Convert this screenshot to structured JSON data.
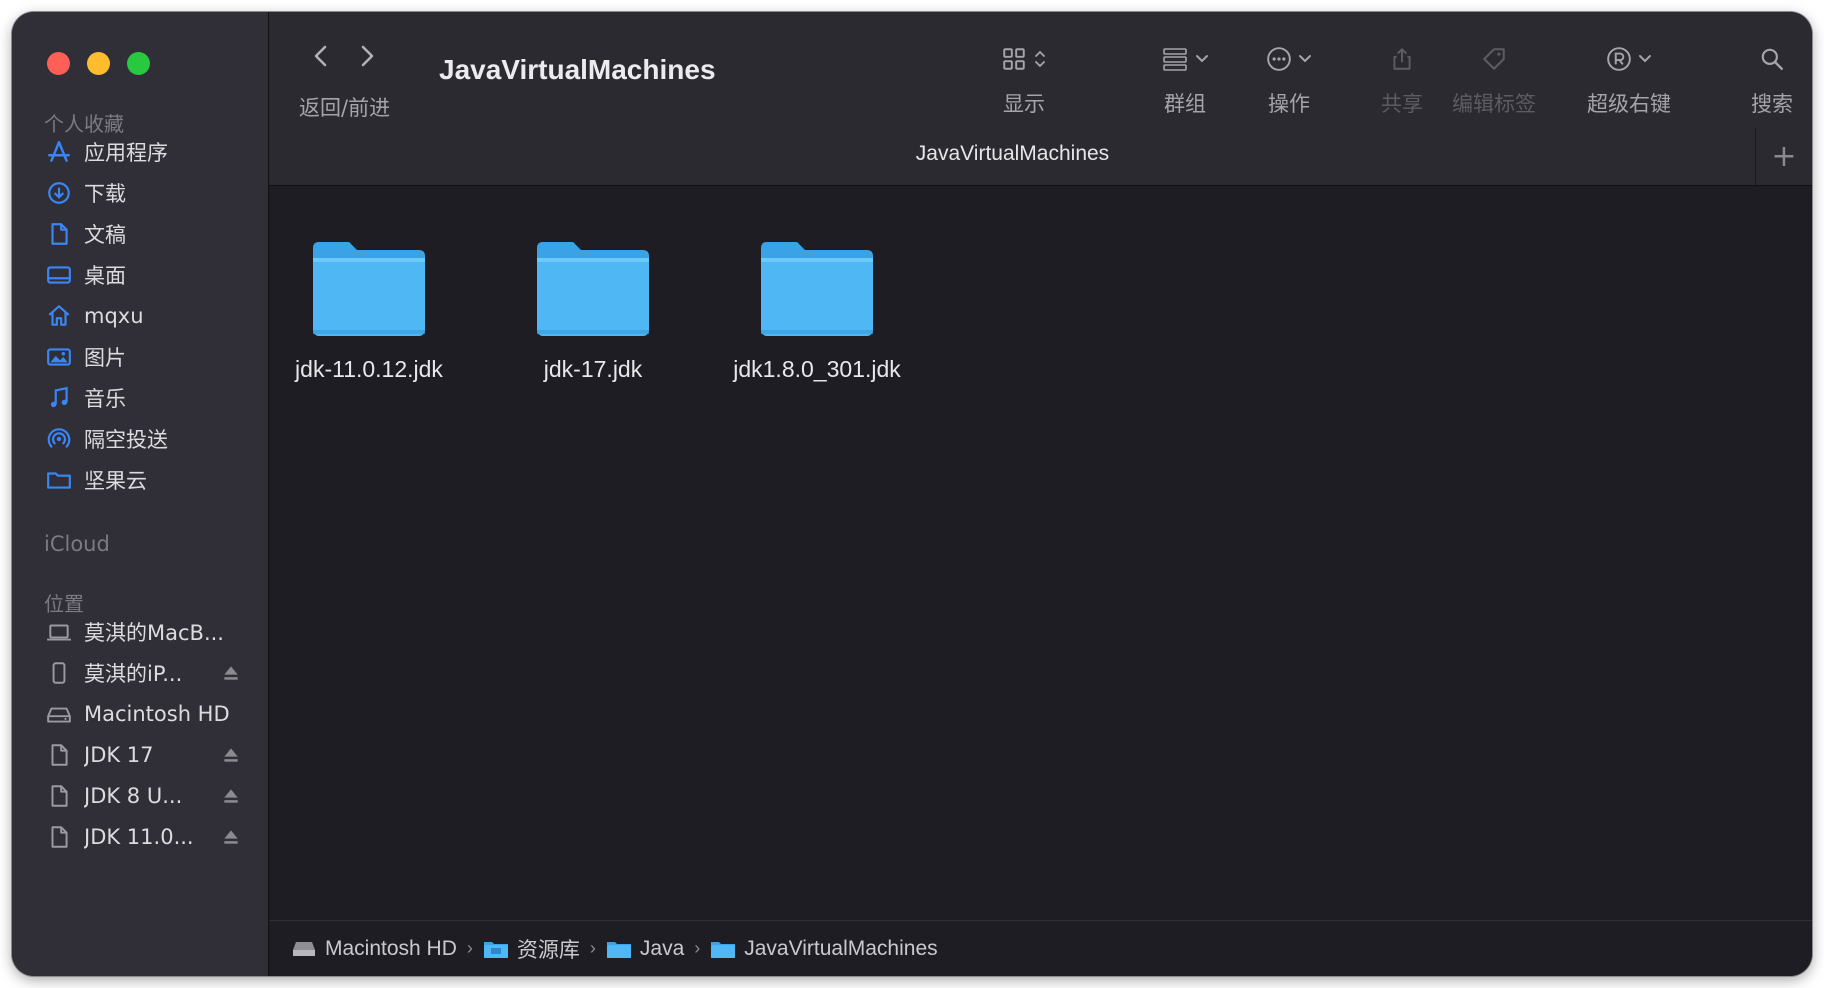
{
  "window": {
    "title": "JavaVirtualMachines",
    "tab_title": "JavaVirtualMachines",
    "tab_add_label": "+"
  },
  "toolbar": {
    "nav_label": "返回/前进",
    "view_label": "显示",
    "group_label": "群组",
    "action_label": "操作",
    "share_label": "共享",
    "tags_label": "编辑标签",
    "super_right_label": "超级右键",
    "search_label": "搜索"
  },
  "sidebar": {
    "favorites_header": "个人收藏",
    "favorites": [
      {
        "label": "应用程序",
        "icon": "applications-icon"
      },
      {
        "label": "下载",
        "icon": "downloads-icon"
      },
      {
        "label": "文稿",
        "icon": "document-icon"
      },
      {
        "label": "桌面",
        "icon": "desktop-icon"
      },
      {
        "label": "mqxu",
        "icon": "home-icon"
      },
      {
        "label": "图片",
        "icon": "pictures-icon"
      },
      {
        "label": "音乐",
        "icon": "music-icon"
      },
      {
        "label": "隔空投送",
        "icon": "airdrop-icon"
      },
      {
        "label": "坚果云",
        "icon": "folder-icon"
      }
    ],
    "icloud_header": "iCloud",
    "locations_header": "位置",
    "locations": [
      {
        "label": "莫淇的MacB...",
        "icon": "laptop-icon",
        "eject": false
      },
      {
        "label": "莫淇的iP...",
        "icon": "phone-icon",
        "eject": true
      },
      {
        "label": "Macintosh HD",
        "icon": "drive-icon",
        "eject": false
      },
      {
        "label": "JDK 17",
        "icon": "disk-image-icon",
        "eject": true
      },
      {
        "label": "JDK 8 U...",
        "icon": "disk-image-icon",
        "eject": true
      },
      {
        "label": "JDK 11.0...",
        "icon": "disk-image-icon",
        "eject": true
      }
    ]
  },
  "files": [
    {
      "name": "jdk-11.0.12.jdk"
    },
    {
      "name": "jdk-17.jdk"
    },
    {
      "name": "jdk1.8.0_301.jdk"
    }
  ],
  "pathbar": [
    {
      "label": "Macintosh HD",
      "icon": "drive-icon"
    },
    {
      "label": "资源库",
      "icon": "library-folder-icon"
    },
    {
      "label": "Java",
      "icon": "folder-icon"
    },
    {
      "label": "JavaVirtualMachines",
      "icon": "folder-icon"
    }
  ],
  "colors": {
    "accent": "#3a86f7",
    "folder": "#4fb7f4",
    "sidebar_bg": "#302f37",
    "content_bg": "#1e1d23"
  }
}
